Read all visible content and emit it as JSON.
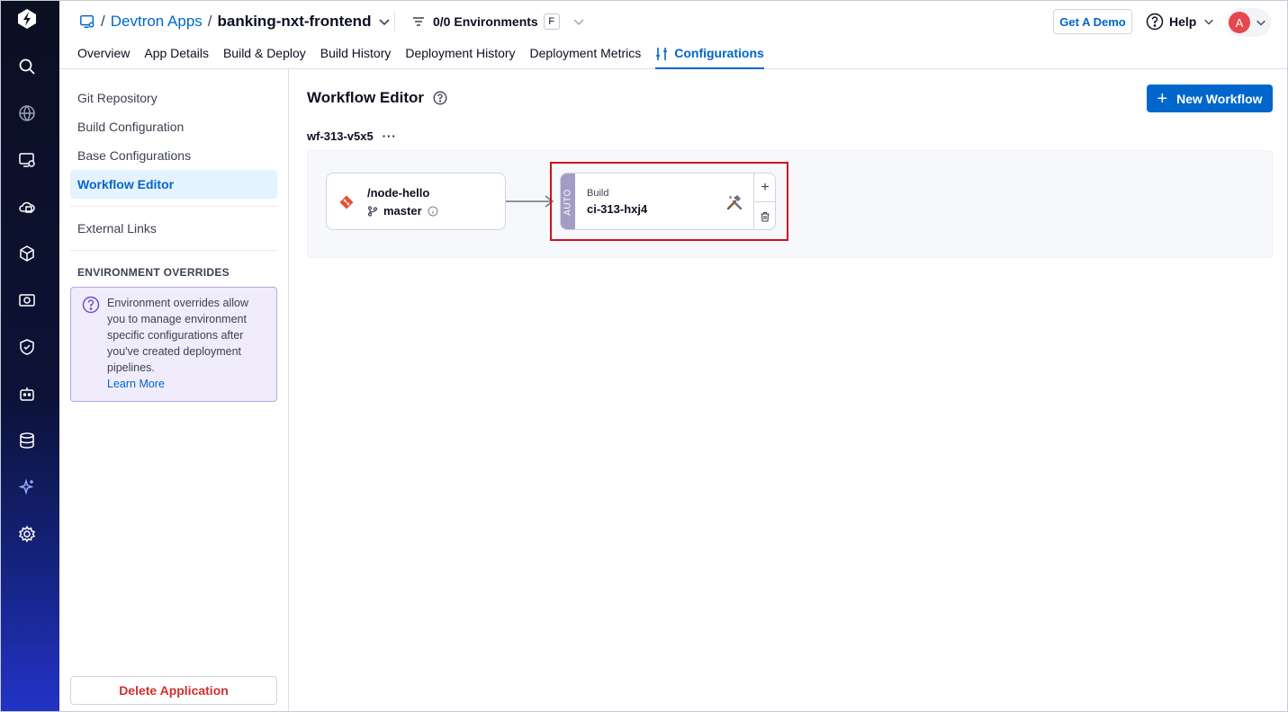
{
  "breadcrumb": {
    "sep1": "/",
    "apps": "Devtron Apps",
    "sep2": "/",
    "app_name": "banking-nxt-frontend"
  },
  "env_filter": {
    "label": "0/0 Environments",
    "badge": "F"
  },
  "header_actions": {
    "demo": "Get A Demo",
    "help": "Help",
    "avatar_initial": "A"
  },
  "tabs": [
    {
      "label": "Overview"
    },
    {
      "label": "App Details"
    },
    {
      "label": "Build & Deploy"
    },
    {
      "label": "Build History"
    },
    {
      "label": "Deployment History"
    },
    {
      "label": "Deployment Metrics"
    },
    {
      "label": "Configurations",
      "active": true
    }
  ],
  "sidebar": {
    "items": [
      {
        "label": "Git Repository"
      },
      {
        "label": "Build Configuration"
      },
      {
        "label": "Base Configurations"
      },
      {
        "label": "Workflow Editor",
        "active": true
      }
    ],
    "external_links": "External Links",
    "env_overrides_heading": "ENVIRONMENT OVERRIDES",
    "env_info": "Environment overrides allow you to manage environment specific configurations after you've created deployment pipelines.",
    "learn_more": "Learn More",
    "delete_app": "Delete Application"
  },
  "main": {
    "title": "Workflow Editor",
    "new_workflow": "New Workflow",
    "workflow_name": "wf-313-v5x5",
    "menu_dots": "···"
  },
  "workflow": {
    "git_node": {
      "path": "/node-hello",
      "branch": "master"
    },
    "build_node": {
      "trigger": "AUTO",
      "label": "Build",
      "name": "ci-313-hxj4",
      "add": "+"
    }
  },
  "colors": {
    "accent": "#0066cc",
    "highlight": "#d0111b",
    "auto_strip": "#a59cc6",
    "danger": "#d0302f"
  },
  "icons": {
    "nav": [
      "search-icon",
      "globe-icon",
      "applications-icon",
      "cloud-icon",
      "package-icon",
      "deploy-icon",
      "shield-icon",
      "bot-icon",
      "database-icon",
      "sparkle-icon",
      "settings-icon"
    ]
  }
}
